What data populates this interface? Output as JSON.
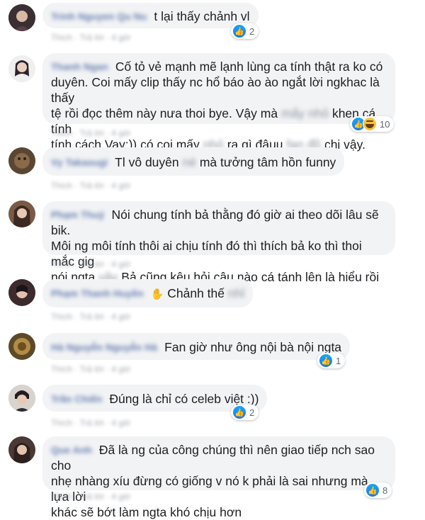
{
  "comments": [
    {
      "name": "Trinh Nguyen Qu Nu",
      "text": "t lại thấy chảnh vl",
      "actions": "Thích · Trả lời · 4 giờ",
      "reactions": {
        "count": "2"
      }
    },
    {
      "name": "Thanh Ngan",
      "line1": "Cố tỏ vẻ mạnh mẽ lạnh lùng ca tính thật ra ko có",
      "line2": "duyên. Coi mấy clip thấy nc hổ báo ào ào ngắt lời ngkhac là thấy",
      "line3a": "tệ rồi đọc thêm này nưa thoi bye. Vậy mà",
      "line3blur": "mấy nhỏ",
      "line3b": "khen cá tính",
      "line4a": "tính cách Vay:)) có coi mấy",
      "line4blur": "nhỏ",
      "line4b": "ra gì đâuu",
      "line4blur2": "fan đồ",
      "line4c": "chi vậy.",
      "actions": "Thích · Trả lời · 4 giờ",
      "reactions": {
        "count": "10"
      }
    },
    {
      "name": "Vy Takasugi",
      "text_a": "Tl vô duyên",
      "text_blur": "nè",
      "text_b": "mà tưởng tâm hồn funny",
      "actions": "Thích · Trả lời · 4 giờ"
    },
    {
      "name": "Phạm Thuỷ",
      "line1": "Nói chung tính bả thằng đó giờ ai theo dõi lâu sẽ bik.",
      "line2": "Môi ng môi tính thôi ai chịu tính đó thì thích bả ko thì thoi mắc gig",
      "line3a": "nói ngta",
      "line3blur": "vậy",
      "line3b": "Bả cũng kêu hỏi câu nào cá tánh lên là hiểu rồi",
      "actions": "Thích · Trả lời · 4 giờ"
    },
    {
      "name": "Phạm Thanh Huyền",
      "text_a": "Chảnh thế",
      "text_blur": "nhỉ",
      "actions": "Thích · Trả lời · 4 giờ"
    },
    {
      "name": "Hà Nguyễn Nguyễn Hà",
      "text": "Fan giờ như ông nội bà nội ngta",
      "actions": "Thích · Trả lời · 4 giờ",
      "reactions": {
        "count": "1"
      }
    },
    {
      "name": "Trần Chiến",
      "text": "Đúng là chỉ có celeb việt :))",
      "actions": "Thích · Trả lời · 4 giờ",
      "reactions": {
        "count": "2"
      }
    },
    {
      "name": "Que Anh",
      "line1": "Đã là ng của công chúng thì nên giao tiếp nch sao cho",
      "line2": "nhẹ nhàng xíu đừng có giống v nó k phải là sai nhưng mà lựa lời",
      "line3": "khác sẽ bớt làm ngta khó chịu hơn",
      "actions": "Thích · Trả lời · 4 giờ",
      "reactions": {
        "count": "8"
      }
    }
  ],
  "icons": {
    "like": "like-icon",
    "haha": "haha-icon",
    "wave": "waving-hand-icon"
  },
  "colors": {
    "bubble": "#f2f3f5",
    "name": "#385898",
    "like": "#1877f2"
  }
}
